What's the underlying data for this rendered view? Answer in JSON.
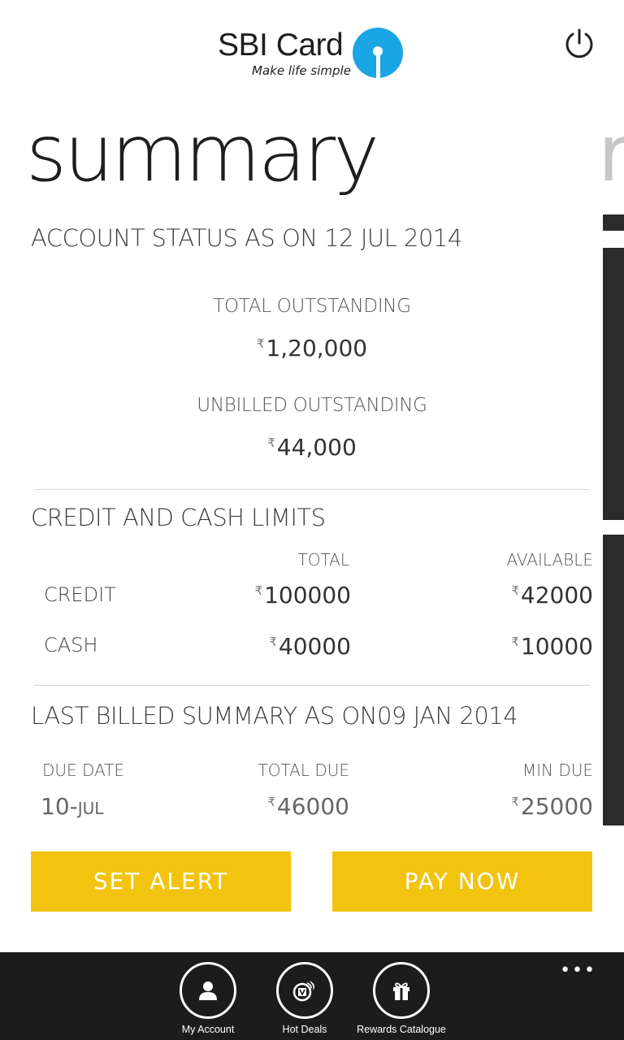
{
  "header": {
    "brand_name": "SBI Card",
    "tagline": "Make life simple",
    "brand_color": "#1aa6e4",
    "power_icon": "power-icon"
  },
  "page": {
    "title": "summary",
    "next_title_peek": "r"
  },
  "account_status": {
    "heading": "ACCOUNT STATUS AS ON 12 JUL 2014",
    "total_outstanding_label": "TOTAL OUTSTANDING",
    "total_outstanding_value": "1,20,000",
    "unbilled_outstanding_label": "UNBILLED OUTSTANDING",
    "unbilled_outstanding_value": "44,000",
    "currency_symbol": "₹"
  },
  "limits": {
    "heading": "CREDIT AND CASH LIMITS",
    "col_total": "TOTAL",
    "col_available": "AVAILABLE",
    "rows": [
      {
        "label": "CREDIT",
        "total": "100000",
        "available": "42000"
      },
      {
        "label": "CASH",
        "total": "40000",
        "available": "10000"
      }
    ]
  },
  "last_billed": {
    "heading": "LAST BILLED SUMMARY AS ON09 JAN 2014",
    "col_due_date": "DUE DATE",
    "col_total_due": "TOTAL DUE",
    "col_min_due": "MIN DUE",
    "due_date_day": "10-",
    "due_date_month": "JUL",
    "total_due": "46000",
    "min_due": "25000"
  },
  "actions": {
    "set_alert": "SET ALERT",
    "pay_now": "PAY NOW",
    "accent_color": "#f2c40f"
  },
  "app_bar": {
    "more": "•••",
    "items": [
      {
        "label": "My Account",
        "icon": "user-icon"
      },
      {
        "label": "Hot Deals",
        "icon": "hot-deals-icon"
      },
      {
        "label": "Rewards Catalogue",
        "icon": "gift-icon"
      }
    ]
  }
}
